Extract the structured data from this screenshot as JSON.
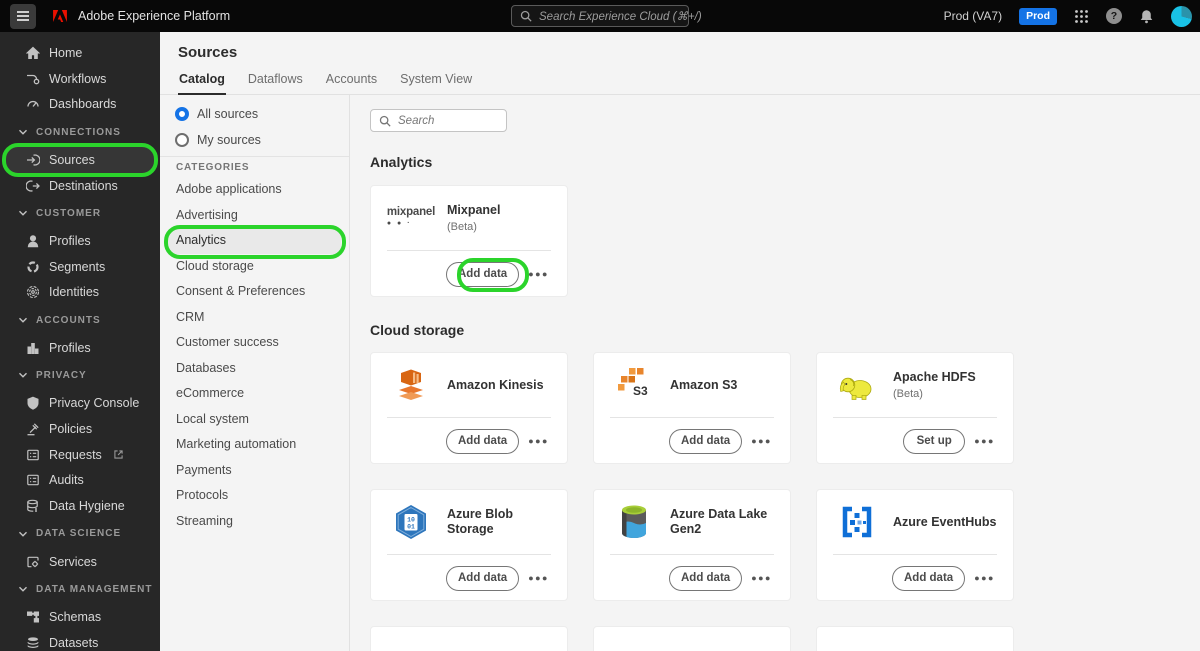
{
  "topbar": {
    "app_title": "Adobe Experience Platform",
    "search_placeholder": "Search Experience Cloud (⌘+/)",
    "environment": "Prod (VA7)",
    "environment_badge": "Prod"
  },
  "sidebar": {
    "top_items": [
      {
        "label": "Home"
      },
      {
        "label": "Workflows"
      },
      {
        "label": "Dashboards"
      }
    ],
    "sections": [
      {
        "label": "CONNECTIONS",
        "items": [
          {
            "label": "Sources"
          },
          {
            "label": "Destinations"
          }
        ]
      },
      {
        "label": "CUSTOMER",
        "items": [
          {
            "label": "Profiles"
          },
          {
            "label": "Segments"
          },
          {
            "label": "Identities"
          }
        ]
      },
      {
        "label": "ACCOUNTS",
        "items": [
          {
            "label": "Profiles"
          }
        ]
      },
      {
        "label": "PRIVACY",
        "items": [
          {
            "label": "Privacy Console"
          },
          {
            "label": "Policies"
          },
          {
            "label": "Requests"
          },
          {
            "label": "Audits"
          },
          {
            "label": "Data Hygiene"
          }
        ]
      },
      {
        "label": "DATA SCIENCE",
        "items": [
          {
            "label": "Services"
          }
        ]
      },
      {
        "label": "DATA MANAGEMENT",
        "items": [
          {
            "label": "Schemas"
          },
          {
            "label": "Datasets"
          }
        ]
      }
    ]
  },
  "page": {
    "title": "Sources",
    "tabs": [
      {
        "label": "Catalog"
      },
      {
        "label": "Dataflows"
      },
      {
        "label": "Accounts"
      },
      {
        "label": "System View"
      }
    ]
  },
  "filters": {
    "radios": [
      {
        "label": "All sources"
      },
      {
        "label": "My sources"
      }
    ],
    "categories_label": "CATEGORIES",
    "categories": [
      "Adobe applications",
      "Advertising",
      "Analytics",
      "Cloud storage",
      "Consent & Preferences",
      "CRM",
      "Customer success",
      "Databases",
      "eCommerce",
      "Local system",
      "Marketing automation",
      "Payments",
      "Protocols",
      "Streaming"
    ]
  },
  "catalog": {
    "search_placeholder": "Search",
    "sections": [
      {
        "heading": "Analytics",
        "cards": [
          {
            "name": "Mixpanel",
            "beta": "(Beta)",
            "action": "Add data"
          }
        ]
      },
      {
        "heading": "Cloud storage",
        "cards": [
          {
            "name": "Amazon Kinesis",
            "action": "Add data"
          },
          {
            "name": "Amazon S3",
            "action": "Add data"
          },
          {
            "name": "Apache HDFS",
            "beta": "(Beta)",
            "action": "Set up"
          },
          {
            "name": "Azure Blob Storage",
            "action": "Add data"
          },
          {
            "name": "Azure Data Lake Gen2",
            "action": "Add data"
          },
          {
            "name": "Azure EventHubs",
            "action": "Add data"
          }
        ]
      }
    ]
  },
  "icons": {
    "more": "●●●",
    "mixpanel_wordmark": "mixpanel",
    "mixpanel_dots": "● ● ·",
    "s3_label": "S3",
    "blob_line1": "10",
    "blob_line2": "01"
  },
  "colors": {
    "accent_blue": "#1473E6",
    "annotation_green": "#2BD42B",
    "topbar_bg": "#080808",
    "sidebar_bg": "#272727"
  }
}
